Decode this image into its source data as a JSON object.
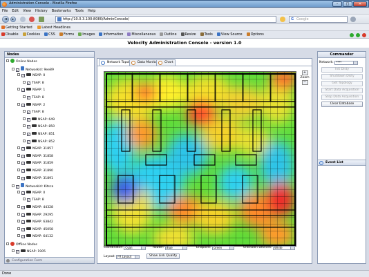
{
  "window": {
    "title": "Administration Console - Mozilla Firefox",
    "min": "–",
    "max": "□",
    "close": "✕"
  },
  "menu": [
    "File",
    "Edit",
    "View",
    "History",
    "Bookmarks",
    "Tools",
    "Help"
  ],
  "nav": {
    "back": "◄",
    "forward": "►",
    "url": "http://10.0.3.100:8080/AdminConsole/",
    "search_placeholder": "Google",
    "search_logo": "G"
  },
  "bookmarks": [
    "Getting Started",
    "Latest Headlines"
  ],
  "devbar": [
    "Disable",
    "Cookies",
    "CSS",
    "Forms",
    "Images",
    "Information",
    "Miscellaneous",
    "Outline",
    "Resize",
    "Tools",
    "View Source",
    "Options"
  ],
  "app": {
    "title": "Velocity Administration Console - version 1.0"
  },
  "nodes": {
    "header": "Nodes",
    "footer": "Configuration Form",
    "rows": [
      {
        "label": "Online Nodes",
        "level": 0,
        "kind": "group",
        "status": "#2eaa2e"
      },
      {
        "label": "NetworkId: 9ee89",
        "level": 1,
        "kind": "net"
      },
      {
        "label": "NSAP: 0",
        "level": 2,
        "kind": "node"
      },
      {
        "label": "TSAP: 8",
        "level": 3,
        "kind": "leaf"
      },
      {
        "label": "NSAP: 1",
        "level": 2,
        "kind": "node"
      },
      {
        "label": "TSAP: 8",
        "level": 3,
        "kind": "leaf"
      },
      {
        "label": "NSAP: 2",
        "level": 2,
        "kind": "node"
      },
      {
        "label": "TSAP: 8",
        "level": 3,
        "kind": "leaf"
      },
      {
        "label": "NSAP: 649",
        "level": 3,
        "kind": "node"
      },
      {
        "label": "NSAP: 850",
        "level": 3,
        "kind": "node"
      },
      {
        "label": "NSAP: 851",
        "level": 3,
        "kind": "node"
      },
      {
        "label": "NSAP: 852",
        "level": 3,
        "kind": "node"
      },
      {
        "label": "NSAP: 31857",
        "level": 2,
        "kind": "node"
      },
      {
        "label": "NSAP: 31858",
        "level": 2,
        "kind": "node"
      },
      {
        "label": "NSAP: 31859",
        "level": 2,
        "kind": "node"
      },
      {
        "label": "NSAP: 31890",
        "level": 2,
        "kind": "node"
      },
      {
        "label": "NSAP: 31891",
        "level": 2,
        "kind": "node"
      },
      {
        "label": "NetworkId: Kitsca",
        "level": 1,
        "kind": "net"
      },
      {
        "label": "NSAP: 0",
        "level": 2,
        "kind": "node"
      },
      {
        "label": "TSAP: 8",
        "level": 3,
        "kind": "leaf"
      },
      {
        "label": "NSAP: 44328",
        "level": 2,
        "kind": "node"
      },
      {
        "label": "NSAP: 29295",
        "level": 2,
        "kind": "node"
      },
      {
        "label": "NSAP: 63842",
        "level": 2,
        "kind": "node"
      },
      {
        "label": "NSAP: 45058",
        "level": 2,
        "kind": "node"
      },
      {
        "label": "NSAP: 64132",
        "level": 2,
        "kind": "node"
      },
      {
        "label": "Offline Nodes",
        "level": 0,
        "kind": "group",
        "status": "#d83a2a"
      },
      {
        "label": "NSAP: 1905",
        "level": 1,
        "kind": "node"
      }
    ]
  },
  "tabs": [
    "Network Topology",
    "Data Monitor",
    "Chart"
  ],
  "zoom": {
    "label": "Zoom",
    "plus": "+",
    "minus": "−"
  },
  "controls": {
    "coordinator_label": "Coordinator:",
    "coordinator_value": "Cyan",
    "router_label": "Router:",
    "router_value": "Blue",
    "endpoint_label": "Endpoint:",
    "endpoint_value": "Green",
    "unknown_label": "Unknown Devices:",
    "unknown_value": "White",
    "layout_label": "Layout:",
    "layout_value": "FR Layout",
    "link_quality_button": "Show Link Quality"
  },
  "commander": {
    "header": "Commander",
    "network_label": "Network:",
    "network_value": "****",
    "buttons": [
      {
        "label": "Init Disty",
        "enabled": false
      },
      {
        "label": "Shutdown Disty",
        "enabled": false
      },
      {
        "label": "Get Topology",
        "enabled": false
      },
      {
        "label": "Start Data Acquisition",
        "enabled": false
      },
      {
        "label": "Stop Data Acquisition",
        "enabled": false
      },
      {
        "label": "Clear Database",
        "enabled": true
      }
    ],
    "event_list": "Event List"
  },
  "status": "Done",
  "colors": {
    "online": "#2eaa2e",
    "offline": "#d83a2a",
    "accent": "#3b73c4"
  }
}
